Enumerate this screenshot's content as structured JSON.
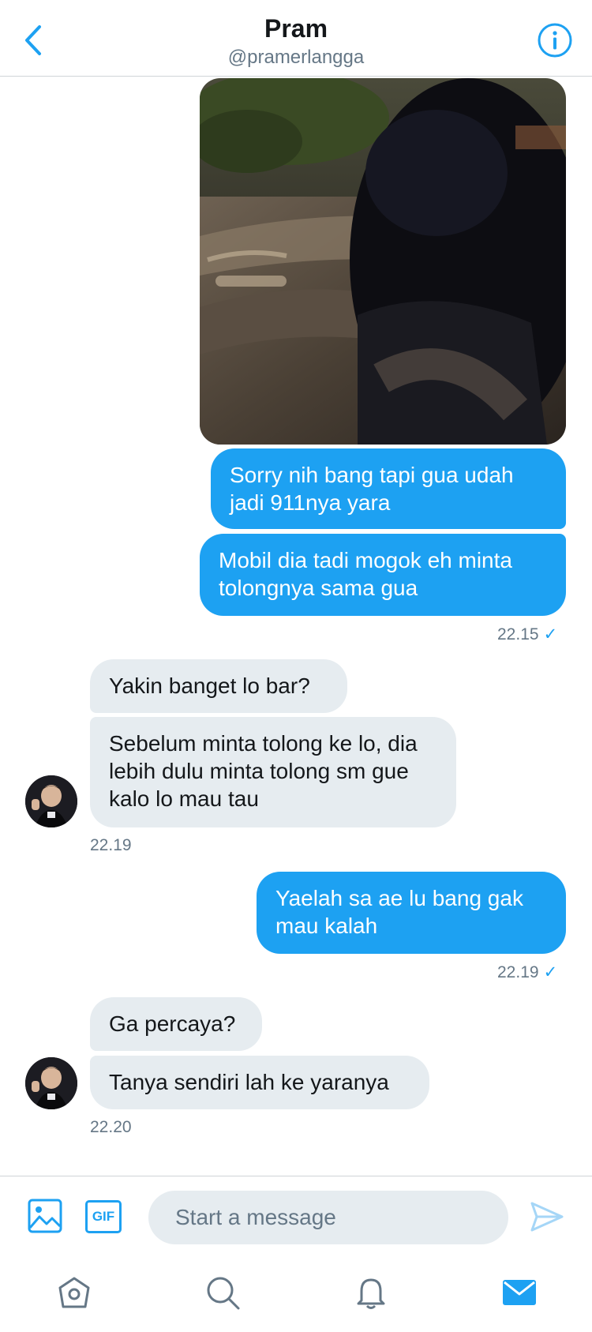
{
  "header": {
    "title": "Pram",
    "handle": "@pramerlangga"
  },
  "messages": {
    "out1": "Sorry nih bang tapi gua udah jadi 911nya yara",
    "out2": "Mobil dia tadi mogok eh minta tolongnya sama gua",
    "time1": "22.15",
    "in1": "Yakin banget lo bar?",
    "in2": "Sebelum minta tolong ke lo, dia lebih dulu minta tolong sm gue kalo lo mau tau",
    "time2": "22.19",
    "out3": "Yaelah sa ae lu bang gak mau kalah",
    "time3": "22.19",
    "in3": "Ga percaya?",
    "in4": "Tanya sendiri lah ke yaranya",
    "time4": "22.20",
    "check_glyph": "✓"
  },
  "composer": {
    "gif_label": "GIF",
    "placeholder": "Start a message"
  },
  "icons": {
    "back": "chevron-left-icon",
    "info": "info-icon",
    "image": "image-icon",
    "send": "send-icon",
    "home": "home-icon",
    "search": "search-icon",
    "notifications": "bell-icon",
    "messages": "mail-icon"
  },
  "colors": {
    "accent": "#1da1f2",
    "incoming_bubble": "#e6ecf0",
    "muted_text": "#657786"
  }
}
